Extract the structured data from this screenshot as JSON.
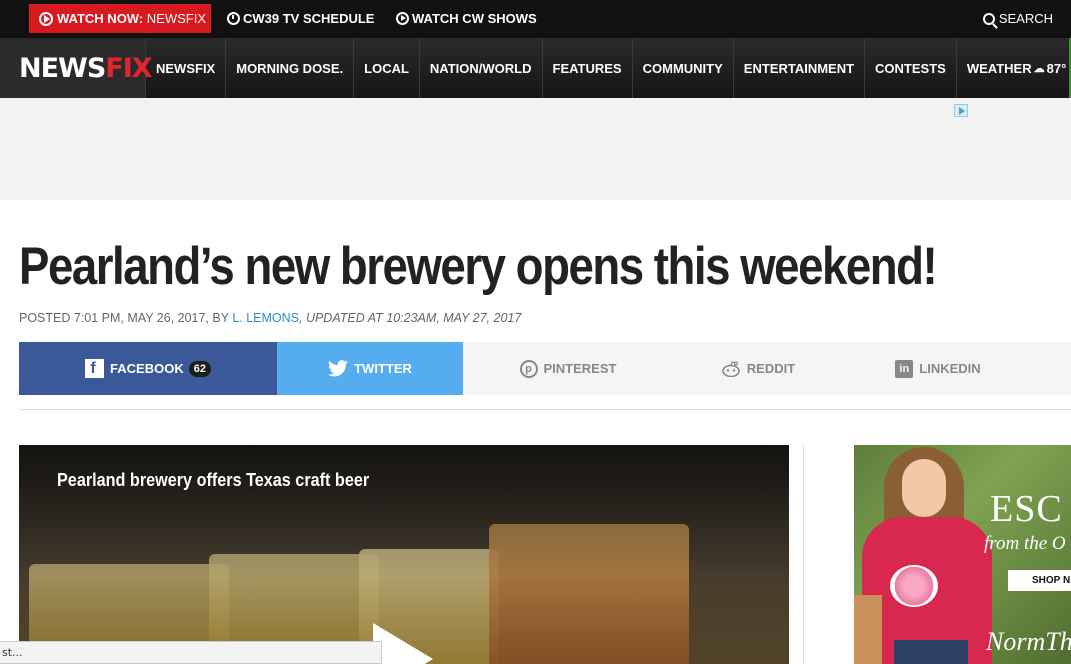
{
  "topbar": {
    "watch_now_label": "WATCH NOW:",
    "watch_now_channel": "NEWSFIX",
    "schedule_label": "CW39 TV SCHEDULE",
    "shows_label": "WATCH CW SHOWS",
    "search_label": "SEARCH"
  },
  "nav": {
    "logo_news": "NEWS",
    "logo_fix": "FIX",
    "items": [
      "NEWSFIX",
      "MORNING DOSE.",
      "LOCAL",
      "NATION/WORLD",
      "FEATURES",
      "COMMUNITY",
      "ENTERTAINMENT",
      "CONTESTS"
    ],
    "weather_label": "WEATHER",
    "weather_temp": "87°"
  },
  "article": {
    "headline": "Pearland’s new brewery opens this weekend!",
    "posted": "POSTED 7:01 PM, MAY 26, 2017, BY ",
    "author": "L. LEMONS",
    "updated": ", UPDATED AT 10:23AM, MAY 27, 2017"
  },
  "share": {
    "facebook": "FACEBOOK",
    "facebook_count": "62",
    "twitter": "TWITTER",
    "pinterest": "PINTEREST",
    "reddit": "REDDIT",
    "linkedin": "LINKEDIN"
  },
  "video": {
    "title": "Pearland brewery offers Texas craft beer"
  },
  "side_ad": {
    "headline": "ESC",
    "subline": "from the O",
    "button": "SHOP N",
    "brand": "NormTh"
  },
  "statusbar": {
    "text": "st..."
  },
  "colors": {
    "accent_red": "#d71920",
    "facebook": "#3b5998",
    "twitter": "#55acee",
    "link_blue": "#2a8fc9"
  }
}
